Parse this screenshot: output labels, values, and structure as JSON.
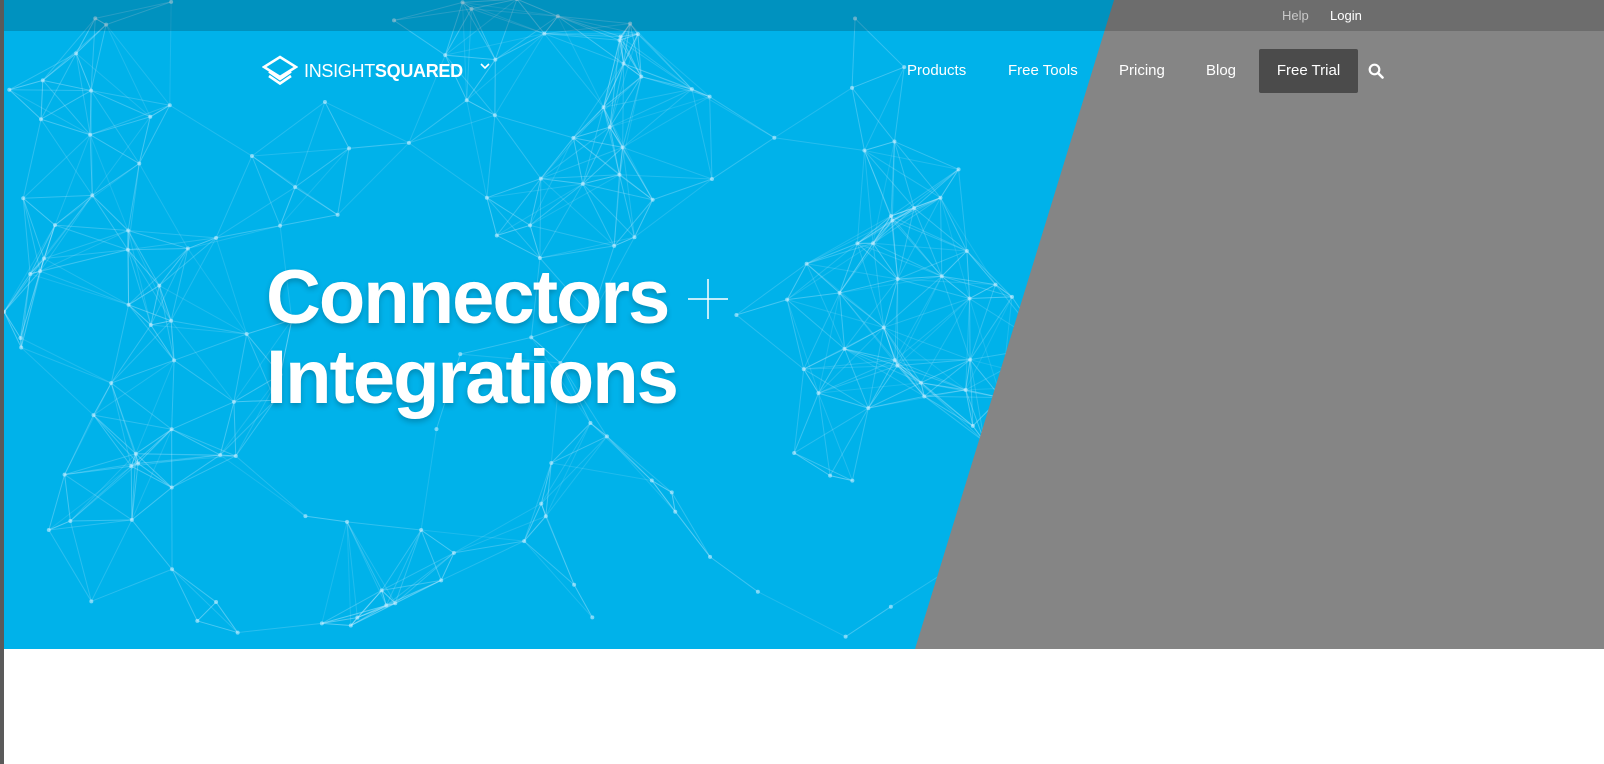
{
  "utility_nav": {
    "help": "Help",
    "login": "Login"
  },
  "logo": {
    "part1": "INSIGHT",
    "part2": "SQUARED"
  },
  "nav": {
    "items": [
      {
        "label": "Products"
      },
      {
        "label": "Free Tools"
      },
      {
        "label": "Pricing"
      },
      {
        "label": "Blog"
      }
    ],
    "cta": "Free Trial"
  },
  "hero": {
    "line1": "Connectors",
    "line2": "Integrations"
  },
  "icons": {
    "logo_mark": "insightsquared-logo-icon",
    "dropdown": "chevron-down-icon",
    "search": "search-icon",
    "plus": "plus-icon"
  },
  "colors": {
    "brand_blue": "#00b2ea",
    "panel_gray": "#858585",
    "cta_bg": "#4b4b4b"
  }
}
